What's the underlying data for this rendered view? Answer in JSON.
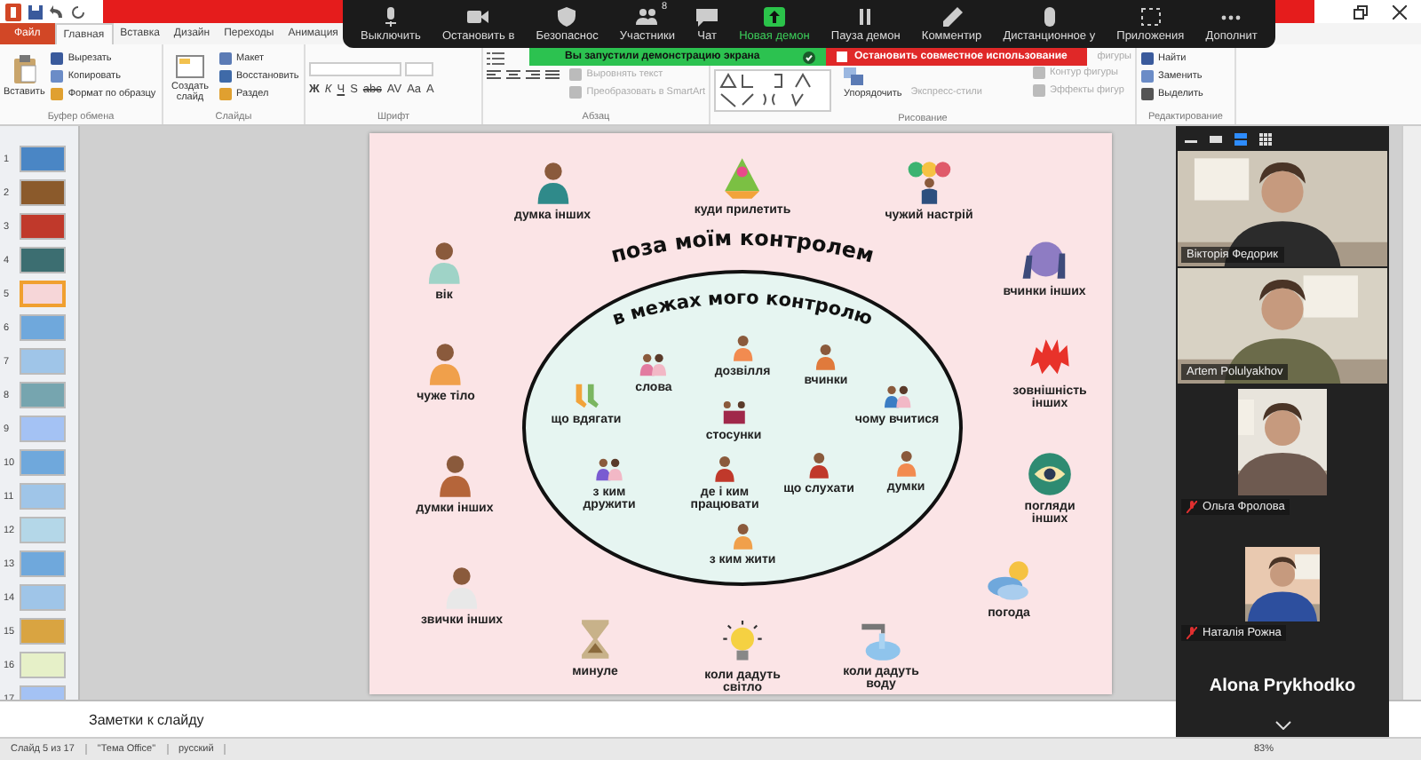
{
  "ribbon": {
    "tabs": [
      {
        "label": "Файл",
        "kind": "backstage",
        "selected": false
      },
      {
        "label": "Главная",
        "kind": "tab",
        "selected": true
      },
      {
        "label": "Вставка",
        "kind": "tab",
        "selected": false
      },
      {
        "label": "Дизайн",
        "kind": "tab",
        "selected": false
      },
      {
        "label": "Переходы",
        "kind": "tab",
        "selected": false
      },
      {
        "label": "Анимация",
        "kind": "tab",
        "selected": false
      }
    ],
    "groups": [
      {
        "label": "Буфер обмена",
        "commands": [
          {
            "label": "Вставить",
            "disabled": false
          },
          {
            "label": "Вырезать",
            "disabled": false
          },
          {
            "label": "Копировать",
            "disabled": false
          },
          {
            "label": "Формат по образцу",
            "disabled": false
          }
        ]
      },
      {
        "label": "Слайды",
        "commands": [
          {
            "label": "Создать слайд",
            "disabled": false
          },
          {
            "label": "Макет",
            "disabled": false
          },
          {
            "label": "Восстановить",
            "disabled": false
          },
          {
            "label": "Раздел",
            "disabled": false
          }
        ]
      },
      {
        "label": "Шрифт",
        "commands": [
          {
            "label": "Ж",
            "disabled": false
          },
          {
            "label": "К",
            "disabled": false
          },
          {
            "label": "Ч",
            "disabled": false
          },
          {
            "label": "S",
            "disabled": false
          },
          {
            "label": "abc",
            "disabled": false
          },
          {
            "label": "AV",
            "disabled": false
          },
          {
            "label": "Aa",
            "disabled": false
          },
          {
            "label": "A",
            "disabled": false
          }
        ]
      },
      {
        "label": "Абзац",
        "commands": [
          {
            "label": "Выровнять текст",
            "disabled": true
          },
          {
            "label": "Преобразовать в SmartArt",
            "disabled": true
          }
        ]
      },
      {
        "label": "Рисование",
        "commands": [
          {
            "label": "Упорядочить",
            "disabled": false
          },
          {
            "label": "Экспресс-стили",
            "disabled": true
          },
          {
            "label": "фигуры",
            "disabled": true
          },
          {
            "label": "Контур фигуры",
            "disabled": true
          },
          {
            "label": "Эффекты фигур",
            "disabled": true
          }
        ]
      },
      {
        "label": "Редактирование",
        "commands": [
          {
            "label": "Найти",
            "disabled": false
          },
          {
            "label": "Заменить",
            "disabled": false
          },
          {
            "label": "Выделить",
            "disabled": false
          }
        ]
      }
    ]
  },
  "zoom_toolbar": {
    "buttons": [
      {
        "label": "Выключить",
        "kind": "mic",
        "selected": false
      },
      {
        "label": "Остановить в",
        "kind": "camera",
        "selected": false
      },
      {
        "label": "Безопаснос",
        "kind": "shield",
        "selected": false
      },
      {
        "label": "Участники",
        "kind": "people",
        "count": "8",
        "selected": false
      },
      {
        "label": "Чат",
        "kind": "chat",
        "selected": false
      },
      {
        "label": "Новая демон",
        "kind": "share",
        "selected": true
      },
      {
        "label": "Пауза демон",
        "kind": "pause",
        "selected": false
      },
      {
        "label": "Комментир",
        "kind": "pencil",
        "selected": false
      },
      {
        "label": "Дистанционное у",
        "kind": "mouse",
        "selected": false
      },
      {
        "label": "Приложения",
        "kind": "apps",
        "selected": false
      },
      {
        "label": "Дополнит",
        "kind": "more",
        "selected": false
      }
    ]
  },
  "share_banner": {
    "status": "Вы запустили демонстрацию экрана",
    "stop_button": "Остановить совместное использование"
  },
  "slide_panel": {
    "slides": [
      {
        "number": "1",
        "selected": false
      },
      {
        "number": "2",
        "selected": false
      },
      {
        "number": "3",
        "selected": false
      },
      {
        "number": "4",
        "selected": false
      },
      {
        "number": "5",
        "selected": true
      },
      {
        "number": "6",
        "selected": false
      },
      {
        "number": "7",
        "selected": false
      },
      {
        "number": "8",
        "selected": false
      },
      {
        "number": "9",
        "selected": false
      },
      {
        "number": "10",
        "selected": false
      },
      {
        "number": "11",
        "selected": false
      },
      {
        "number": "12",
        "selected": false
      },
      {
        "number": "13",
        "selected": false
      },
      {
        "number": "14",
        "selected": false
      },
      {
        "number": "15",
        "selected": false
      },
      {
        "number": "16",
        "selected": false
      },
      {
        "number": "17",
        "selected": false
      }
    ]
  },
  "slide": {
    "outer_title": "поза моїм контролем",
    "inner_title": "в межах мого контролю",
    "outside_items": [
      {
        "label": "думка інших"
      },
      {
        "label": "куди прилетить"
      },
      {
        "label": "чужий настрій"
      },
      {
        "label": "вік"
      },
      {
        "label": "вчинки інших"
      },
      {
        "label": "чуже тіло"
      },
      {
        "label": "зовнішність інших"
      },
      {
        "label": "думки інших"
      },
      {
        "label": "погляди інших"
      },
      {
        "label": "звички інших"
      },
      {
        "label": "погода"
      },
      {
        "label": "минуле"
      },
      {
        "label": "коли дадуть світло"
      },
      {
        "label": "коли дадуть воду"
      }
    ],
    "inside_items": [
      {
        "label": "слова"
      },
      {
        "label": "дозвілля"
      },
      {
        "label": "вчинки"
      },
      {
        "label": "що вдягати"
      },
      {
        "label": "стосунки"
      },
      {
        "label": "чому вчитися"
      },
      {
        "label": "з ким дружити"
      },
      {
        "label": "де і ким працювати"
      },
      {
        "label": "що слухати"
      },
      {
        "label": "думки"
      },
      {
        "label": "з ким жити"
      }
    ]
  },
  "video_panel": {
    "tiles": [
      {
        "name": "Вікторія Федорик",
        "muted": false
      },
      {
        "name": "Artem Polulyakhov",
        "muted": false
      },
      {
        "name": "Ольга Фролова",
        "muted": true
      },
      {
        "name": "Наталія Рожна",
        "muted": true
      }
    ],
    "active_speaker": "Alona Prykhodko"
  },
  "notes": {
    "placeholder": "Заметки к слайду"
  },
  "status_bar": {
    "slide": "Слайд 5 из 17",
    "theme": "\"Тема Office\"",
    "language": "русский",
    "zoom": "83%"
  }
}
